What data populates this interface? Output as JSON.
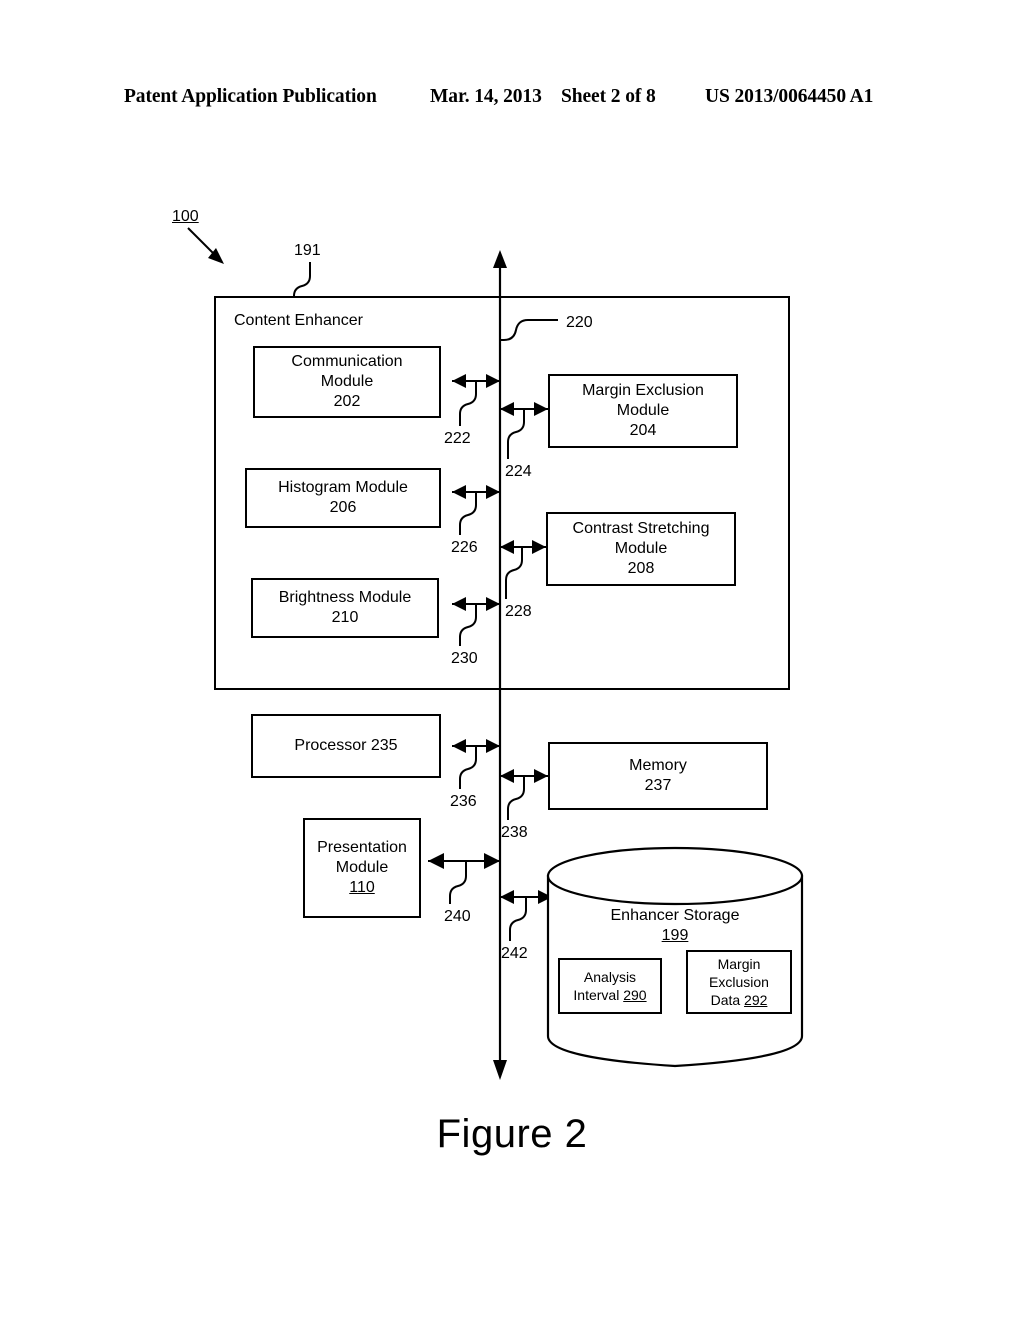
{
  "header": {
    "publication": "Patent Application Publication",
    "date": "Mar. 14, 2013",
    "sheet": "Sheet 2 of 8",
    "publication_number": "US 2013/0064450 A1"
  },
  "figure": {
    "caption": "Figure 2",
    "system_ref": "100"
  },
  "diagram": {
    "content_enhancer": {
      "title": "Content Enhancer",
      "ref": "191",
      "bus_ref": "220",
      "modules": [
        {
          "name": "communication-module",
          "line1": "Communication",
          "line2": "Module",
          "ref": "202",
          "connector_ref": "222"
        },
        {
          "name": "margin-exclusion-module",
          "line1": "Margin Exclusion",
          "line2": "Module",
          "ref": "204",
          "connector_ref": "224"
        },
        {
          "name": "histogram-module",
          "line1": "Histogram Module",
          "line2": "",
          "ref": "206",
          "connector_ref": "226"
        },
        {
          "name": "contrast-stretching-module",
          "line1": "Contrast Stretching",
          "line2": "Module",
          "ref": "208",
          "connector_ref": "228"
        },
        {
          "name": "brightness-module",
          "line1": "Brightness Module",
          "line2": "",
          "ref": "210",
          "connector_ref": "230"
        }
      ]
    },
    "processor": {
      "label": "Processor 235",
      "connector_ref": "236"
    },
    "memory": {
      "line1": "Memory",
      "ref": "237",
      "connector_ref": "238"
    },
    "presentation_module": {
      "line1": "Presentation",
      "line2": "Module",
      "ref": "110",
      "connector_ref": "240"
    },
    "enhancer_storage": {
      "title": "Enhancer Storage",
      "ref": "199",
      "connector_ref": "242",
      "items": [
        {
          "name": "analysis-interval",
          "line1": "Analysis",
          "line2": "Interval",
          "ref": "290"
        },
        {
          "name": "margin-exclusion-data",
          "line1": "Margin",
          "line2": "Exclusion",
          "line3": "Data",
          "ref": "292"
        }
      ]
    }
  },
  "colors": {
    "ink": "#000000",
    "paper": "#ffffff"
  }
}
